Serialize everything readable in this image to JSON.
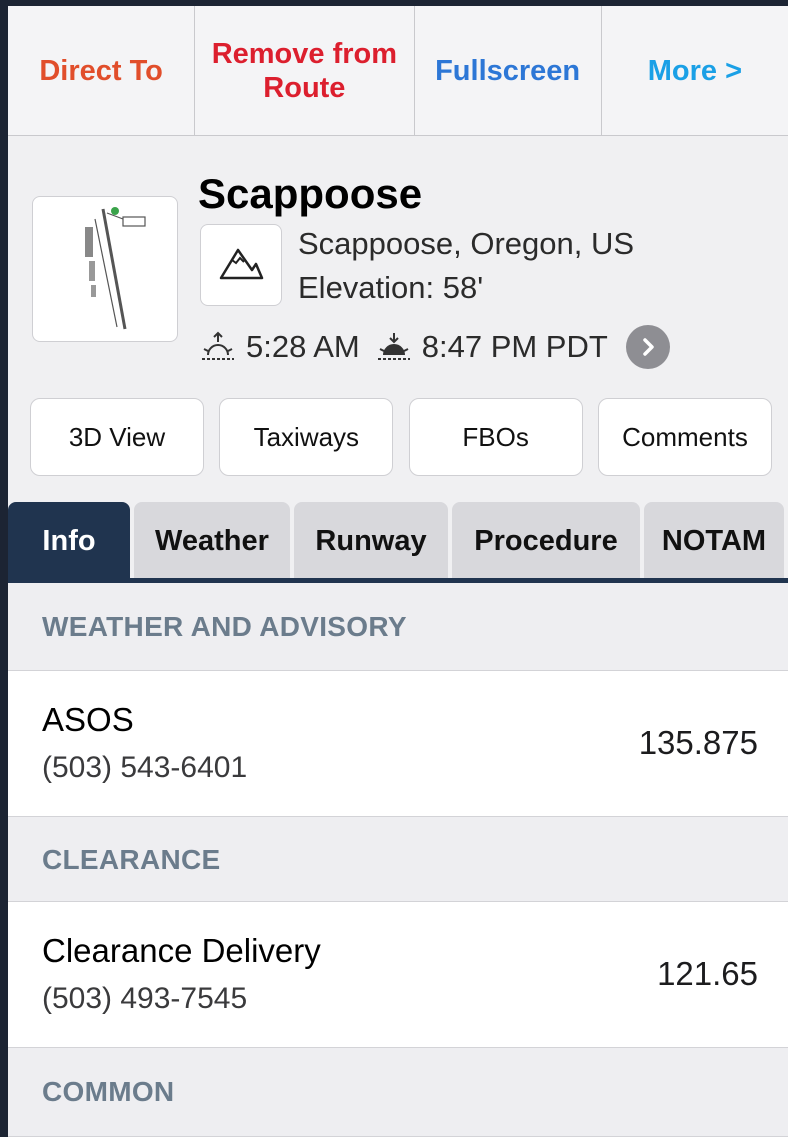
{
  "actions": [
    {
      "label": "Direct To",
      "color": "#e14e2b"
    },
    {
      "label": "Remove from Route",
      "color": "#dc1f2e"
    },
    {
      "label": "Fullscreen",
      "color": "#2d77d6"
    },
    {
      "label": "More >",
      "color": "#1aa0e6"
    }
  ],
  "airport": {
    "name": "Scappoose",
    "location": "Scappoose, Oregon, US",
    "elevation": "Elevation: 58'",
    "sunrise": "5:28 AM",
    "sunset": "8:47 PM PDT",
    "type_icon": "mountain-icon"
  },
  "buttons": [
    "3D View",
    "Taxiways",
    "FBOs",
    "Comments"
  ],
  "tabs": [
    {
      "label": "Info",
      "active": true
    },
    {
      "label": "Weather",
      "active": false
    },
    {
      "label": "Runway",
      "active": false
    },
    {
      "label": "Procedure",
      "active": false
    },
    {
      "label": "NOTAM",
      "active": false
    }
  ],
  "sections": [
    {
      "header": "WEATHER AND ADVISORY",
      "rows": [
        {
          "name": "ASOS",
          "phone": "(503) 543-6401",
          "freq": "135.875"
        }
      ]
    },
    {
      "header": "CLEARANCE",
      "rows": [
        {
          "name": "Clearance Delivery",
          "phone": "(503) 493-7545",
          "freq": "121.65"
        }
      ]
    },
    {
      "header": "COMMON",
      "rows": []
    }
  ],
  "colors": {
    "tab_active": "#20344f",
    "section_text": "#6b7c8c"
  }
}
